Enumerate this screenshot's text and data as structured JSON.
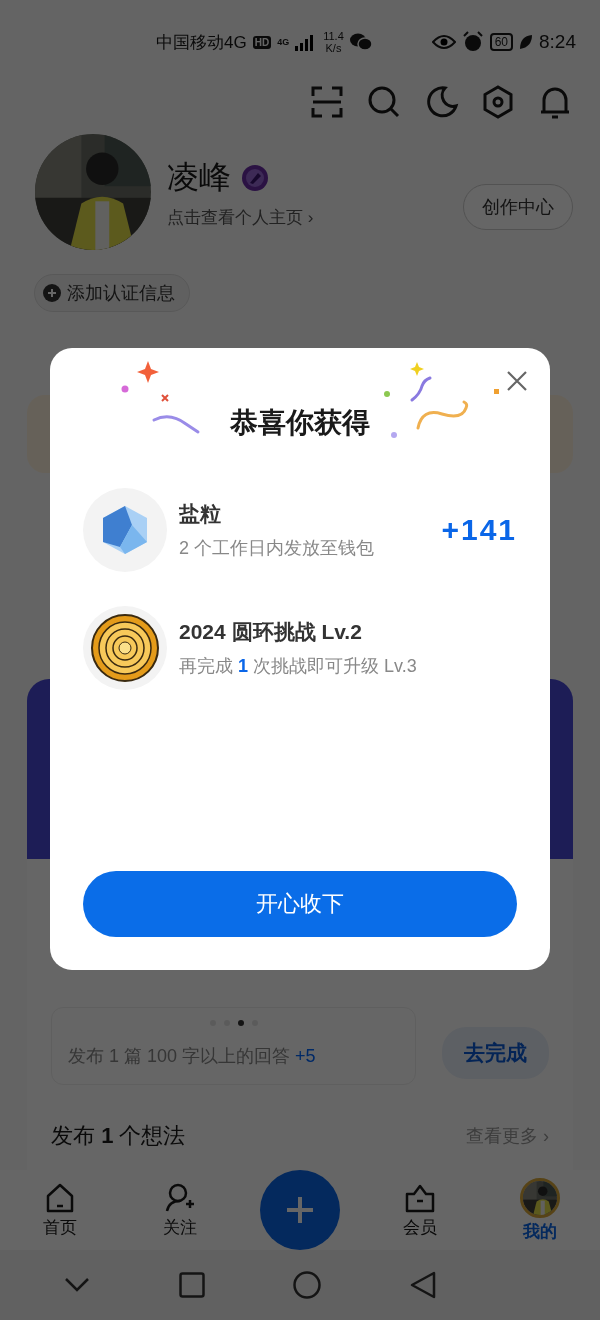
{
  "status_bar": {
    "carrier": "中国移动4G",
    "hd": "HD",
    "network": "4G",
    "speed_value": "11.4",
    "speed_unit": "K/s",
    "battery": "60",
    "time": "8:24"
  },
  "profile": {
    "name": "凌峰",
    "subtitle": "点击查看个人主页 ›",
    "creator_button": "创作中心",
    "verify_chip": "添加认证信息"
  },
  "task": {
    "text": "发布 1 篇 100 字以上的回答 **+5**",
    "button": "去完成",
    "dots": [
      {
        "selected": false
      },
      {
        "selected": false
      },
      {
        "selected": true
      },
      {
        "selected": false
      }
    ]
  },
  "section": {
    "title": "发布 **1** 个想法",
    "more": "查看更多 ›"
  },
  "bottom_nav": [
    {
      "label": "首页",
      "kind": "home",
      "selected": false
    },
    {
      "label": "关注",
      "kind": "follow",
      "selected": false
    },
    {
      "kind": "plus",
      "selected": false
    },
    {
      "label": "会员",
      "kind": "vip",
      "selected": false
    },
    {
      "label": "我的",
      "kind": "avatar",
      "selected": true
    }
  ],
  "dialog": {
    "title": "恭喜你获得",
    "button": "开心收下",
    "rewards": [
      {
        "kind": "salt",
        "name": "盐粒",
        "desc": "2 个工作日内发放至钱包",
        "amount": "+141"
      },
      {
        "kind": "ring",
        "name": "2024 圆环挑战 Lv.2",
        "desc": "再完成 **1** 次挑战即可升级 Lv.3"
      }
    ]
  }
}
